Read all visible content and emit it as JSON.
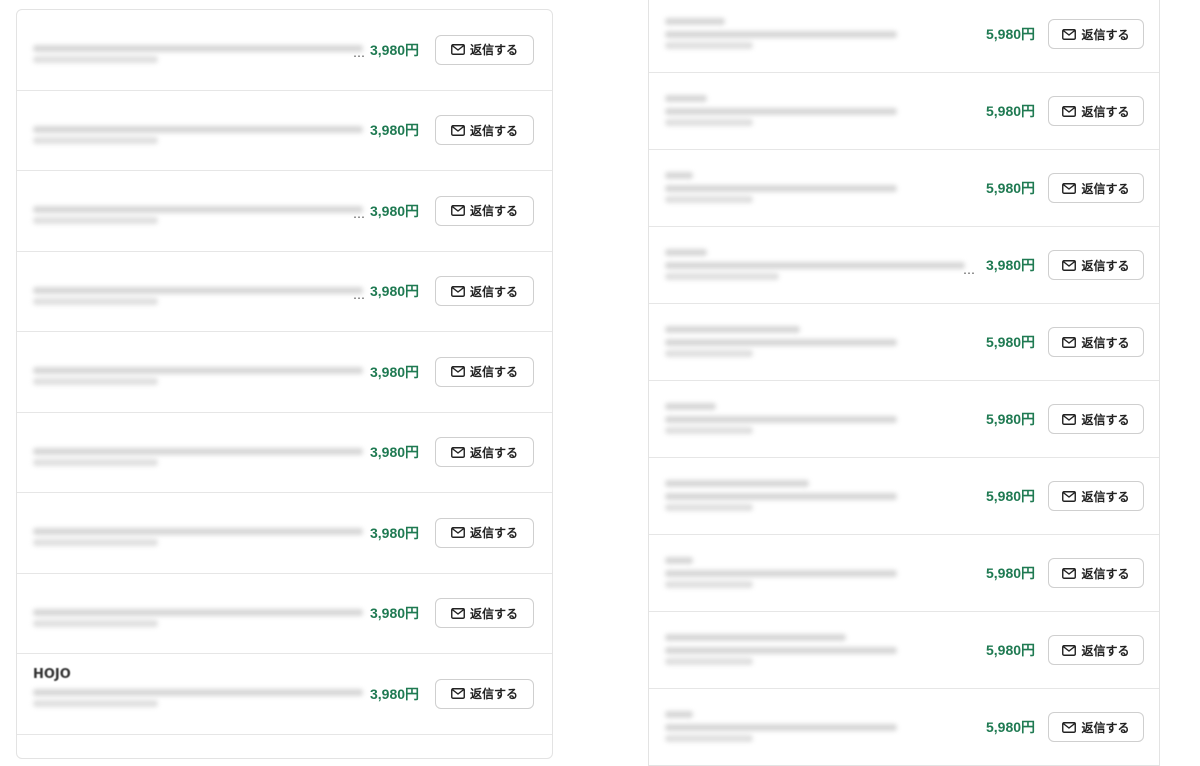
{
  "left_list": {
    "rows": [
      {
        "price": "3,980円",
        "reply_label": "返信する",
        "name": "",
        "ellipsis": "…"
      },
      {
        "price": "3,980円",
        "reply_label": "返信する",
        "name": "",
        "ellipsis": ""
      },
      {
        "price": "3,980円",
        "reply_label": "返信する",
        "name": "",
        "ellipsis": "…"
      },
      {
        "price": "3,980円",
        "reply_label": "返信する",
        "name": "",
        "ellipsis": "…"
      },
      {
        "price": "3,980円",
        "reply_label": "返信する",
        "name": "",
        "ellipsis": ""
      },
      {
        "price": "3,980円",
        "reply_label": "返信する",
        "name": "",
        "ellipsis": ""
      },
      {
        "price": "3,980円",
        "reply_label": "返信する",
        "name": "",
        "ellipsis": ""
      },
      {
        "price": "3,980円",
        "reply_label": "返信する",
        "name": "",
        "ellipsis": ""
      },
      {
        "price": "3,980円",
        "reply_label": "返信する",
        "name": "HOJO",
        "ellipsis": ""
      }
    ]
  },
  "right_list": {
    "rows": [
      {
        "price": "5,980円",
        "reply_label": "返信する",
        "ellipsis": ""
      },
      {
        "price": "5,980円",
        "reply_label": "返信する",
        "ellipsis": ""
      },
      {
        "price": "5,980円",
        "reply_label": "返信する",
        "ellipsis": ""
      },
      {
        "price": "3,980円",
        "reply_label": "返信する",
        "ellipsis": "…"
      },
      {
        "price": "5,980円",
        "reply_label": "返信する",
        "ellipsis": ""
      },
      {
        "price": "5,980円",
        "reply_label": "返信する",
        "ellipsis": ""
      },
      {
        "price": "5,980円",
        "reply_label": "返信する",
        "ellipsis": ""
      },
      {
        "price": "5,980円",
        "reply_label": "返信する",
        "ellipsis": ""
      },
      {
        "price": "5,980円",
        "reply_label": "返信する",
        "ellipsis": ""
      },
      {
        "price": "5,980円",
        "reply_label": "返信する",
        "ellipsis": ""
      }
    ]
  },
  "colors": {
    "price_green": "#1f7a52",
    "border": "#e3e3e3"
  },
  "icons": {
    "reply": "mail-icon"
  }
}
